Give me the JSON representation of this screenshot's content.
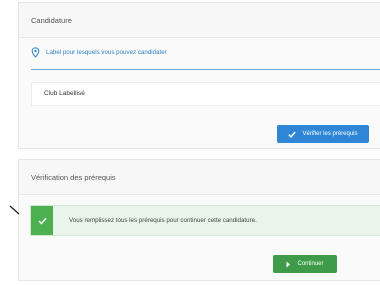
{
  "candidature": {
    "title": "Candidature",
    "label_text": "Label pour lesquels vous pouvez candidater",
    "selected_label": "Club Labellisé",
    "verify_button": "Vérifier les prérequis"
  },
  "verification": {
    "title": "Vérification des prérequis",
    "success_message": "Vous remplissez tous les prérequis pour continuer cette candidature.",
    "continue_button": "Continuer"
  },
  "colors": {
    "primary": "#2f86d6",
    "success": "#4caf50",
    "continue": "#3e9b4a"
  },
  "icons": {
    "label": "map-pin-icon",
    "verify": "checkmark-icon",
    "alert": "checkmark-icon",
    "continue": "chevron-right-icon"
  }
}
